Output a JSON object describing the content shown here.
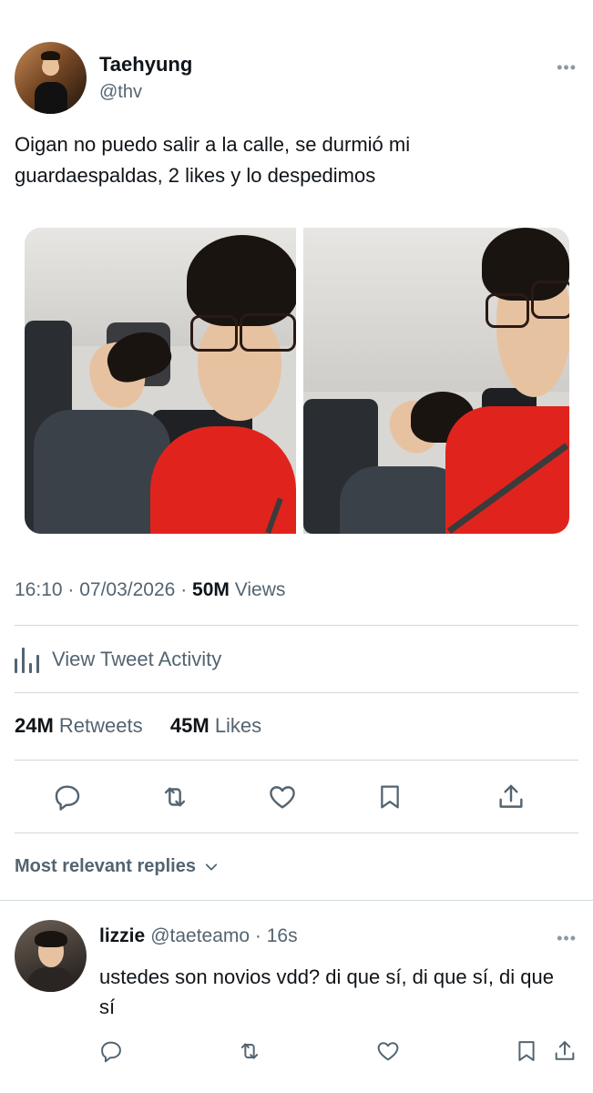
{
  "tweet": {
    "display_name": "Taehyung",
    "handle": "@thv",
    "text": "Oigan no puedo salir a la calle, se durmió mi guardaespaldas, 2 likes y lo despedimos",
    "time": "16:10",
    "date": "07/03/2026",
    "views_count": "50M",
    "views_label": "Views",
    "activity_label": "View Tweet Activity",
    "retweets_count": "24M",
    "retweets_label": "Retweets",
    "likes_count": "45M",
    "likes_label": "Likes",
    "icons": [
      "more-icon",
      "reply-icon",
      "retweet-icon",
      "like-icon",
      "bookmark-icon",
      "share-icon",
      "analytics-icon"
    ]
  },
  "replies": {
    "sort_label": "Most relevant replies",
    "items": [
      {
        "display_name": "lizzie",
        "handle": "@taeteamo",
        "time": "16s",
        "text": "ustedes son novios vdd? di que sí, di que sí, di que sí"
      }
    ]
  },
  "colors": {
    "text": "#0f1419",
    "muted": "#536471",
    "divider": "#cfd9de"
  }
}
